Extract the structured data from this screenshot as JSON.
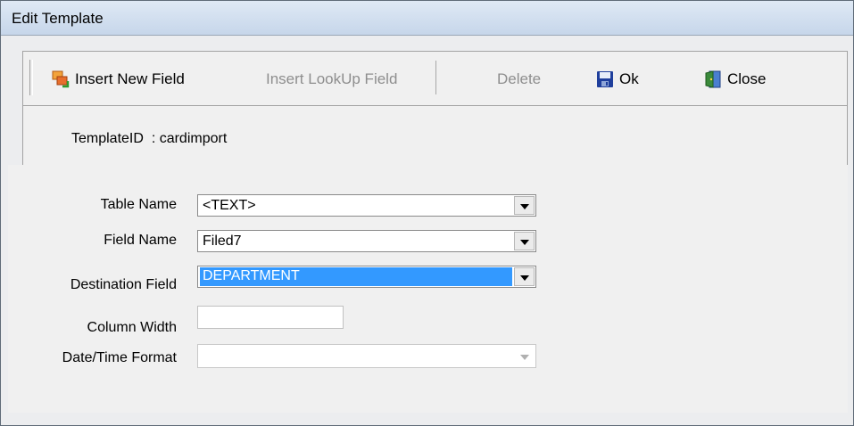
{
  "window": {
    "title": "Edit Template"
  },
  "toolbar": {
    "insert_new_field": "Insert New Field",
    "insert_lookup_field": "Insert LookUp Field",
    "delete": "Delete",
    "ok": "Ok",
    "close": "Close"
  },
  "info": {
    "template_line": "TemplateID  : cardimport"
  },
  "form": {
    "table_name": {
      "label": "Table Name",
      "value": "<TEXT>"
    },
    "field_name": {
      "label": "Field Name",
      "value": "Filed7"
    },
    "destination_field": {
      "label": "Destination Field",
      "value": "DEPARTMENT"
    },
    "column_width": {
      "label": "Column Width",
      "value": ""
    },
    "datetime_format": {
      "label": "Date/Time Format",
      "value": ""
    }
  },
  "colors": {
    "selection": "#3399ff",
    "titlebar": "#c6d6ea"
  },
  "icons": [
    "insert-field-icon",
    "save-disk-icon",
    "door-exit-icon"
  ]
}
